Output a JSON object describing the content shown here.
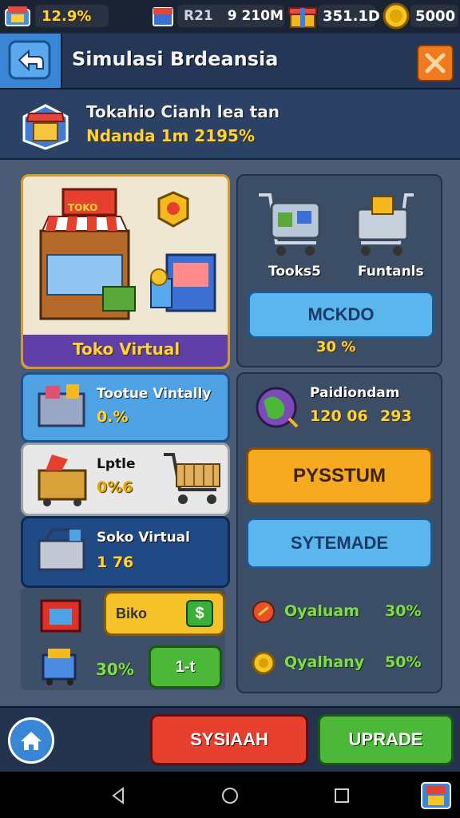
{
  "top_bar": {
    "percent": "12.9%",
    "r_label": "R21",
    "resource_value": "9 210M",
    "gift_value": "351.1D",
    "coins": "5000"
  },
  "header": {
    "title": "Simulasi Brdeansia"
  },
  "info": {
    "line1": "Tokahio Cianh lea tan",
    "line2": "Ndanda  1m  2195%"
  },
  "featured": {
    "store_sign": "TOKO",
    "caption": "Toko Virtual"
  },
  "carts": {
    "left_label": "Tooks5",
    "right_label": "Funtanls",
    "button": "MCKDO",
    "percent": "30 %"
  },
  "list": [
    {
      "title": "Tootue Vintally",
      "value": "0.%"
    },
    {
      "title": "Lptle",
      "value": "0%6"
    },
    {
      "title": "Soko Virtual",
      "value": "1 76"
    }
  ],
  "bottom_left": {
    "btn_label": "Biko",
    "dollar": "$",
    "percent": "30%",
    "btn2_label": "1-t"
  },
  "right_panel": {
    "title": "Paidiondam",
    "value1": "120 06",
    "value2": "293",
    "btn_orange": "PYSSTUM",
    "btn_blue": "SYTEMADE",
    "stat1_label": "Oyaluam",
    "stat1_value": "30%",
    "stat2_label": "Qyalhany",
    "stat2_value": "50%"
  },
  "bottom_bar": {
    "btn_red": "SYSIAAH",
    "btn_green": "UPRADE"
  },
  "colors": {
    "accent_blue": "#5ab6ec",
    "accent_orange": "#f5a91e",
    "accent_red": "#e8402e",
    "accent_green": "#4cb83a",
    "gold": "#ffd23a"
  }
}
